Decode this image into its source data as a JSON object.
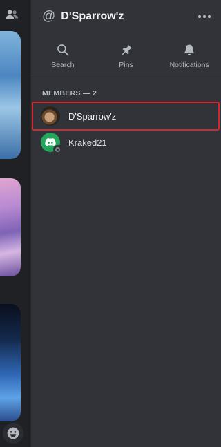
{
  "header": {
    "at_symbol": "@",
    "title": "D'Sparrow'z"
  },
  "toolbar": {
    "search_label": "Search",
    "pins_label": "Pins",
    "notifications_label": "Notifications"
  },
  "members": {
    "section_label": "MEMBERS — 2",
    "items": [
      {
        "name": "D'Sparrow'z",
        "status": "selected"
      },
      {
        "name": "Kraked21",
        "status": "offline"
      }
    ]
  },
  "colors": {
    "panel_bg": "#313338",
    "highlight_outline": "#d8242c",
    "discord_green": "#23a55a"
  }
}
